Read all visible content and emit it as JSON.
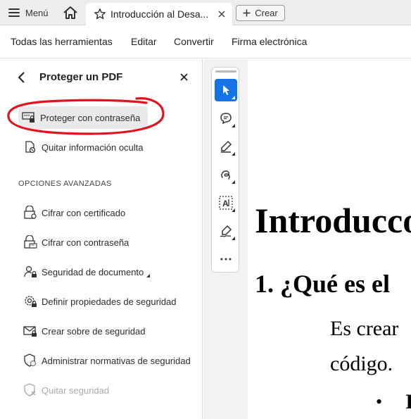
{
  "titlebar": {
    "menu_label": "Menú",
    "tab_title": "Introducción al Desa...",
    "create_label": "Crear"
  },
  "menubar": {
    "items": [
      "Todas las herramientas",
      "Editar",
      "Convertir",
      "Firma electrónica"
    ]
  },
  "panel": {
    "title": "Proteger un PDF",
    "primary_items": [
      {
        "label": "Proteger con contraseña",
        "icon": "password-lock-icon",
        "selected": true
      },
      {
        "label": "Quitar información oculta",
        "icon": "document-eraser-icon"
      }
    ],
    "section_label": "OPCIONES AVANZADAS",
    "advanced_items": [
      {
        "label": "Cifrar con certificado",
        "icon": "certificate-lock-icon"
      },
      {
        "label": "Cifrar con contraseña",
        "icon": "password-lock-icon"
      },
      {
        "label": "Seguridad de documento",
        "icon": "user-lock-icon",
        "flyout": true
      },
      {
        "label": "Definir propiedades de seguridad",
        "icon": "gear-lock-icon"
      },
      {
        "label": "Crear sobre de seguridad",
        "icon": "envelope-lock-icon"
      },
      {
        "label": "Administrar normativas de seguridad",
        "icon": "shield-gear-icon"
      },
      {
        "label": "Quitar seguridad",
        "icon": "shield-x-icon",
        "disabled": true
      }
    ],
    "annotation_color": "#e0141e"
  },
  "toolbar": {
    "tools": [
      "select-pointer-icon",
      "comment-icon",
      "highlight-pen-icon",
      "draw-loop-icon",
      "text-select-icon",
      "sign-pen-icon",
      "more-icon"
    ],
    "accent": "#1473e6"
  },
  "document": {
    "heading1": "Introducco",
    "heading2": "1. ¿Qué es el",
    "para_line1": "Es crear",
    "para_line2": "código.",
    "bullet_text": "I"
  }
}
